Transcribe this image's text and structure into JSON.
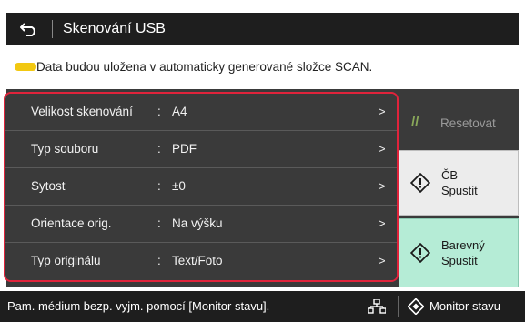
{
  "header": {
    "title": "Skenování USB",
    "back_icon": "back-arrow-icon"
  },
  "info": {
    "message": "Data budou uložena v automaticky generované složce SCAN.",
    "icon": "usb-memory-icon"
  },
  "settings": [
    {
      "label": "Velikost skenování",
      "colon": ":",
      "value": "A4",
      "chevron": ">"
    },
    {
      "label": "Typ souboru",
      "colon": ":",
      "value": "PDF",
      "chevron": ">"
    },
    {
      "label": "Sytost",
      "colon": ":",
      "value": "±0",
      "chevron": ">"
    },
    {
      "label": "Orientace orig.",
      "colon": ":",
      "value": "Na výšku",
      "chevron": ">"
    },
    {
      "label": "Typ originálu",
      "colon": ":",
      "value": "Text/Foto",
      "chevron": ">"
    }
  ],
  "actions": {
    "reset_label": "Resetovat",
    "bw_line1": "ČB",
    "bw_line2": "Spustit",
    "color_line1": "Barevný",
    "color_line2": "Spustit"
  },
  "status_bar": {
    "message": "Pam. médium bezp. vyjm. pomocí [Monitor stavu].",
    "network_icon": "network-icon",
    "monitor_label": "Monitor stavu"
  },
  "colors": {
    "highlight_border": "#e0233b",
    "usb_icon": "#f2c811",
    "color_start_bg": "#b5ecd6",
    "bw_start_bg": "#ececec"
  }
}
